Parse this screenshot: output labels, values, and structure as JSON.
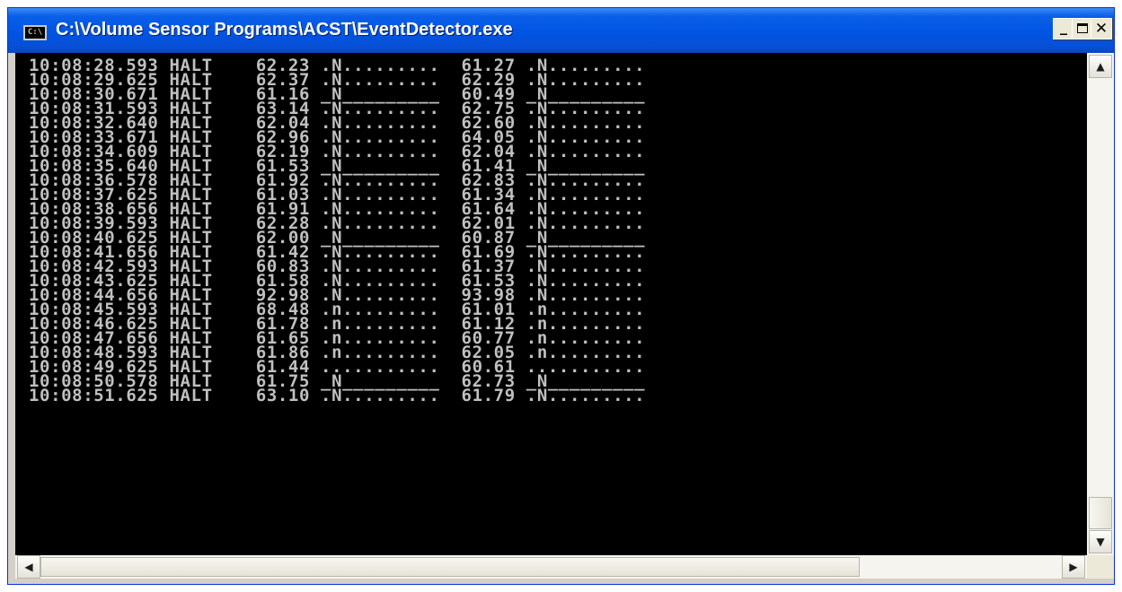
{
  "window": {
    "title": "C:\\Volume Sensor Programs\\ACST\\EventDetector.exe",
    "icon_text": "C:\\",
    "controls": {
      "minimize": "_",
      "maximize": "□",
      "close": "✕"
    }
  },
  "console": {
    "lines": [
      "10:08:28.593 HALT    62.23 .N.........  61.27 .N.........",
      "10:08:29.625 HALT    62.37 .N.........  62.29 .N.........",
      "10:08:30.671 HALT    61.16 _N_________  60.49 _N_________",
      "10:08:31.593 HALT    63.14 .N.........  62.75 .N.........",
      "10:08:32.640 HALT    62.04 .N.........  62.60 .N.........",
      "10:08:33.671 HALT    62.96 .N.........  64.05 .N.........",
      "10:08:34.609 HALT    62.19 .N.........  62.04 .N.........",
      "10:08:35.640 HALT    61.53 _N_________  61.41 _N_________",
      "10:08:36.578 HALT    61.92 .N.........  62.83 .N.........",
      "10:08:37.625 HALT    61.03 .N.........  61.34 .N.........",
      "10:08:38.656 HALT    61.91 .N.........  61.64 .N.........",
      "10:08:39.593 HALT    62.28 .N.........  62.01 .N.........",
      "10:08:40.625 HALT    62.00 _N_________  60.87 _N_________",
      "10:08:41.656 HALT    61.42 .N.........  61.69 .N.........",
      "10:08:42.593 HALT    60.83 .N.........  61.37 .N.........",
      "10:08:43.625 HALT    61.58 .N.........  61.53 .N.........",
      "10:08:44.656 HALT    92.98 .N.........  93.98 .N.........",
      "10:08:45.593 HALT    68.48 .n.........  61.01 .n.........",
      "10:08:46.625 HALT    61.78 .n.........  61.12 .n.........",
      "10:08:47.656 HALT    61.65 .n.........  60.77 .n.........",
      "10:08:48.593 HALT    61.86 .n.........  62.05 .n.........",
      "10:08:49.625 HALT    61.44 ...........  60.61 ...........",
      "10:08:50.578 HALT    61.75 _N_________  62.73 _N_________",
      "10:08:51.625 HALT    63.10 .N.........  61.79 .N........."
    ]
  },
  "colors": {
    "console_text": "#c0c0c0",
    "console_background": "#000000",
    "highlight": "#f4f00e",
    "titlebar": "#0054e3"
  },
  "scrollbars": {
    "up_arrow": "▲",
    "down_arrow": "▼",
    "left_arrow": "◀",
    "right_arrow": "▶",
    "grip": "⋰"
  }
}
